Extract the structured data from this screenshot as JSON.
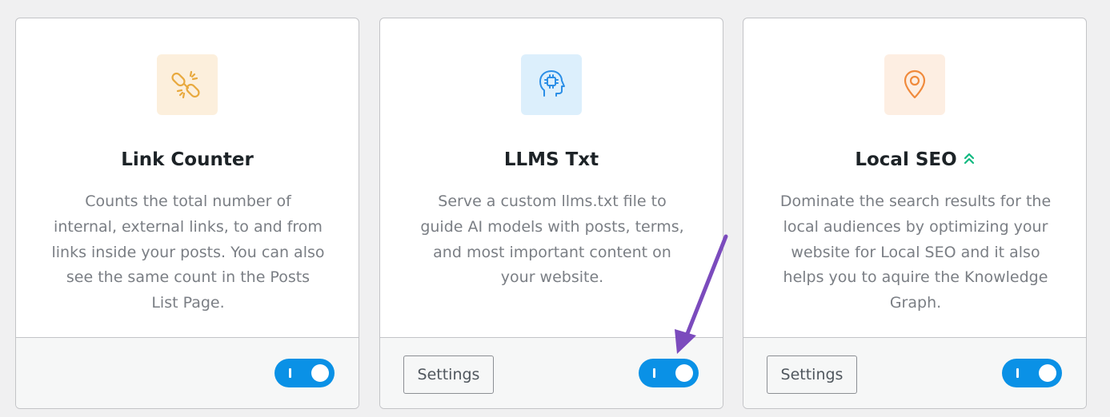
{
  "colors": {
    "toggle_on": "#0a91e6",
    "link_counter_icon_bg": "#fcefdc",
    "link_counter_icon": "#e8a93e",
    "llms_icon_bg": "#dceffc",
    "llms_icon": "#2b8ee6",
    "local_seo_icon_bg": "#fdeee2",
    "local_seo_icon": "#f08a3c",
    "pro_badge": "#10b981",
    "annotation_arrow": "#7b4bbd"
  },
  "cards": [
    {
      "icon": "broken-link-icon",
      "title": "Link Counter",
      "description": "Counts the total number of internal, external links, to and from links inside your posts. You can also see the same count in the Posts List Page.",
      "enabled": true
    },
    {
      "icon": "ai-head-icon",
      "title": "LLMS Txt",
      "description": "Serve a custom llms.txt file to guide AI models with posts, terms, and most important content on your website.",
      "settings_label": "Settings",
      "enabled": true
    },
    {
      "icon": "location-pin-icon",
      "title": "Local SEO",
      "pro_icon": "double-chevron-up-icon",
      "description": "Dominate the search results for the local audiences by optimizing your website for Local SEO and it also helps you to aquire the Knowledge Graph.",
      "settings_label": "Settings",
      "enabled": true
    }
  ],
  "annotation": {
    "icon": "arrow-annotation-icon"
  }
}
